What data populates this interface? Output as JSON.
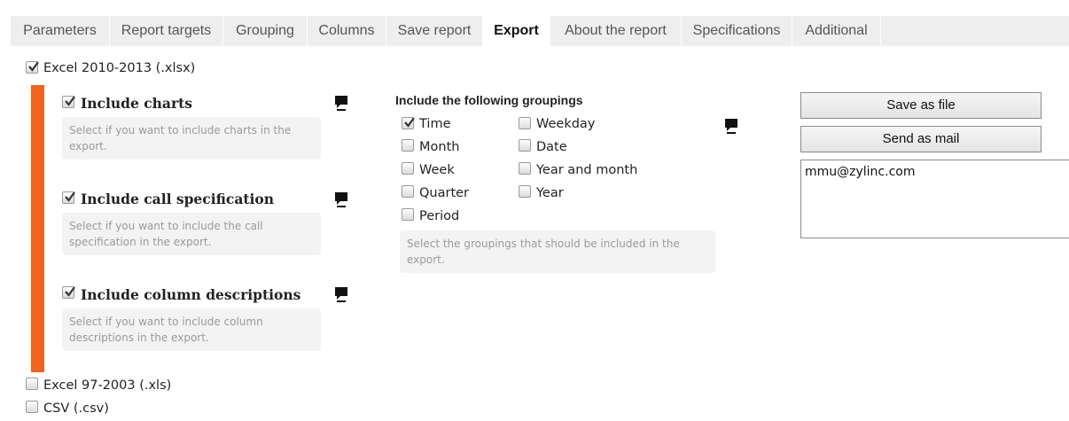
{
  "tabs": [
    {
      "label": "Parameters"
    },
    {
      "label": "Report targets"
    },
    {
      "label": "Grouping"
    },
    {
      "label": "Columns"
    },
    {
      "label": "Save report"
    },
    {
      "label": "Export"
    },
    {
      "label": "About the report"
    },
    {
      "label": "Specifications"
    },
    {
      "label": "Additional"
    }
  ],
  "active_tab": "Export",
  "formats": {
    "xlsx": {
      "label": "Excel 2010-2013 (.xlsx)",
      "checked": true
    },
    "xls": {
      "label": "Excel 97-2003 (.xls)",
      "checked": false
    },
    "csv": {
      "label": "CSV (.csv)",
      "checked": false
    }
  },
  "options": [
    {
      "title": "Include charts",
      "checked": true,
      "help": "Select if you want to include charts in the export."
    },
    {
      "title": "Include call specification",
      "checked": true,
      "help": "Select if you want to include the call specification in the export."
    },
    {
      "title": "Include column descriptions",
      "checked": true,
      "help": "Select if you want to include column descriptions in the export."
    }
  ],
  "groupings": {
    "heading": "Include the following groupings",
    "left": [
      {
        "label": "Time",
        "checked": true
      },
      {
        "label": "Month",
        "checked": false
      },
      {
        "label": "Week",
        "checked": false
      },
      {
        "label": "Quarter",
        "checked": false
      },
      {
        "label": "Period",
        "checked": false
      }
    ],
    "right": [
      {
        "label": "Weekday",
        "checked": false
      },
      {
        "label": "Date",
        "checked": false
      },
      {
        "label": "Year and month",
        "checked": false
      },
      {
        "label": "Year",
        "checked": false
      }
    ],
    "help": "Select the groupings that should be included in the export."
  },
  "actions": {
    "save_as_file": "Save as file",
    "send_as_mail": "Send as mail",
    "mail_recipient": "mmu@zylinc.com"
  },
  "icons": {
    "help_bubble": "chat-bubble-icon",
    "check": "checkmark-icon"
  },
  "colors": {
    "accent": "#f0641e",
    "tab_bar": "#eeeeee",
    "help_bg": "#f3f3f3",
    "help_text": "#9a9a9a"
  }
}
